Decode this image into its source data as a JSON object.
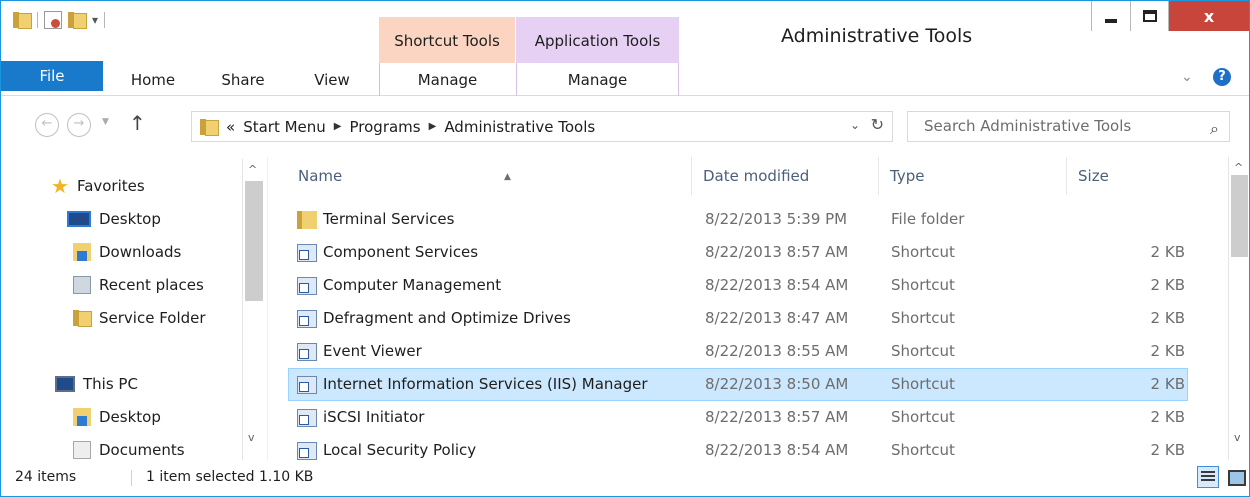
{
  "window": {
    "title": "Administrative Tools"
  },
  "ribbon": {
    "context_groups": [
      {
        "label": "Shortcut Tools",
        "tab": "Manage",
        "color": "#fbd5c2"
      },
      {
        "label": "Application Tools",
        "tab": "Manage",
        "color": "#e6d1f5"
      }
    ],
    "tabs": [
      "File",
      "Home",
      "Share",
      "View"
    ],
    "file_tab_color": "#1979ca"
  },
  "address": {
    "prefix": "«",
    "crumbs": [
      "Start Menu",
      "Programs",
      "Administrative Tools"
    ],
    "search_placeholder": "Search Administrative Tools"
  },
  "nav": {
    "favorites_label": "Favorites",
    "favorites": [
      "Desktop",
      "Downloads",
      "Recent places",
      "Service Folder"
    ],
    "this_pc_label": "This PC",
    "this_pc": [
      "Desktop",
      "Documents"
    ]
  },
  "columns": {
    "name": "Name",
    "date": "Date modified",
    "type": "Type",
    "size": "Size"
  },
  "files": [
    {
      "name": "Terminal Services",
      "date": "8/22/2013 5:39 PM",
      "type": "File folder",
      "size": "",
      "icon": "folder-icon"
    },
    {
      "name": "Component Services",
      "date": "8/22/2013 8:57 AM",
      "type": "Shortcut",
      "size": "2 KB",
      "icon": "component-services-icon"
    },
    {
      "name": "Computer Management",
      "date": "8/22/2013 8:54 AM",
      "type": "Shortcut",
      "size": "2 KB",
      "icon": "computer-management-icon"
    },
    {
      "name": "Defragment and Optimize Drives",
      "date": "8/22/2013 8:47 AM",
      "type": "Shortcut",
      "size": "2 KB",
      "icon": "defragment-icon"
    },
    {
      "name": "Event Viewer",
      "date": "8/22/2013 8:55 AM",
      "type": "Shortcut",
      "size": "2 KB",
      "icon": "event-viewer-icon"
    },
    {
      "name": "Internet Information Services (IIS) Manager",
      "date": "8/22/2013 8:50 AM",
      "type": "Shortcut",
      "size": "2 KB",
      "icon": "iis-manager-icon",
      "selected": true
    },
    {
      "name": "iSCSI Initiator",
      "date": "8/22/2013 8:57 AM",
      "type": "Shortcut",
      "size": "2 KB",
      "icon": "iscsi-icon"
    },
    {
      "name": "Local Security Policy",
      "date": "8/22/2013 8:54 AM",
      "type": "Shortcut",
      "size": "2 KB",
      "icon": "security-policy-icon"
    }
  ],
  "status": {
    "count": "24 items",
    "selection": "1 item selected  1.10 KB"
  }
}
